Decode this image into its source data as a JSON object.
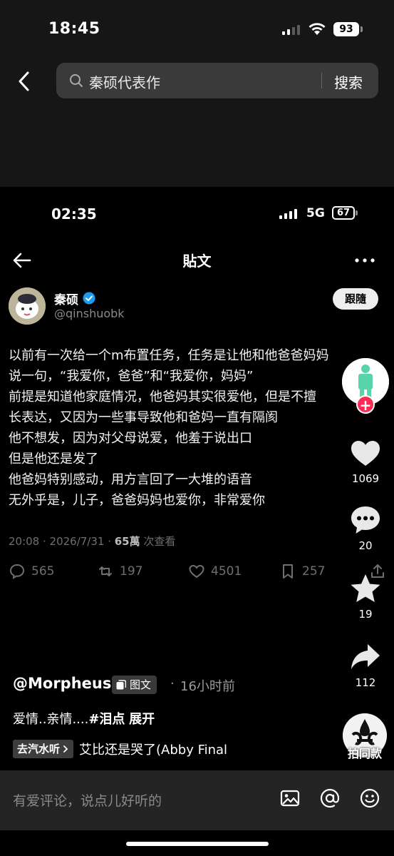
{
  "outer_status": {
    "time": "18:45",
    "battery": "93"
  },
  "search": {
    "query": "秦硕代表作",
    "button": "搜索"
  },
  "inner_status": {
    "time": "02:35",
    "network": "5G",
    "battery": "67"
  },
  "post_header": {
    "title": "貼文"
  },
  "author": {
    "name": "秦硕",
    "handle": "@qinshuobk",
    "follow_label": "跟隨"
  },
  "post": {
    "lines": [
      "以前有一次给一个m布置任务，任务是让他和他爸爸妈妈",
      "说一句，“我爱你，爸爸”和“我爱你，妈妈”",
      "前提是知道他家庭情况，他爸妈其实很爱他，但是不擅",
      "长表达，又因为一些事导致他和爸妈一直有隔阂",
      "他不想发，因为对父母说爱，他羞于说出口",
      "但是他还是发了",
      "他爸妈特别感动，用方言回了一大堆的语音",
      "无外乎是，儿子，爸爸妈妈也爱你，非常爱你"
    ],
    "meta_time": "20:08 · 2026/7/31 · ",
    "meta_views": "65萬",
    "meta_views_label": " 次查看",
    "replies": "565",
    "retweets": "197",
    "likes": "4501",
    "bookmarks": "257"
  },
  "rail": {
    "likes": "1069",
    "comments": "20",
    "favorites": "19",
    "shares": "112",
    "same_style": "拍同款"
  },
  "caption": {
    "username": "@Morpheus",
    "type_tag": "图文",
    "dot": "·",
    "time_ago": "16小时前",
    "desc_text": "爱情..亲情....",
    "hashtag": "#泪点",
    "expand": "展开",
    "music_tag": "去汽水听",
    "music_title": "艾比还是哭了(Abby Final"
  },
  "comment_bar": {
    "placeholder": "有爱评论，说点儿好听的"
  }
}
